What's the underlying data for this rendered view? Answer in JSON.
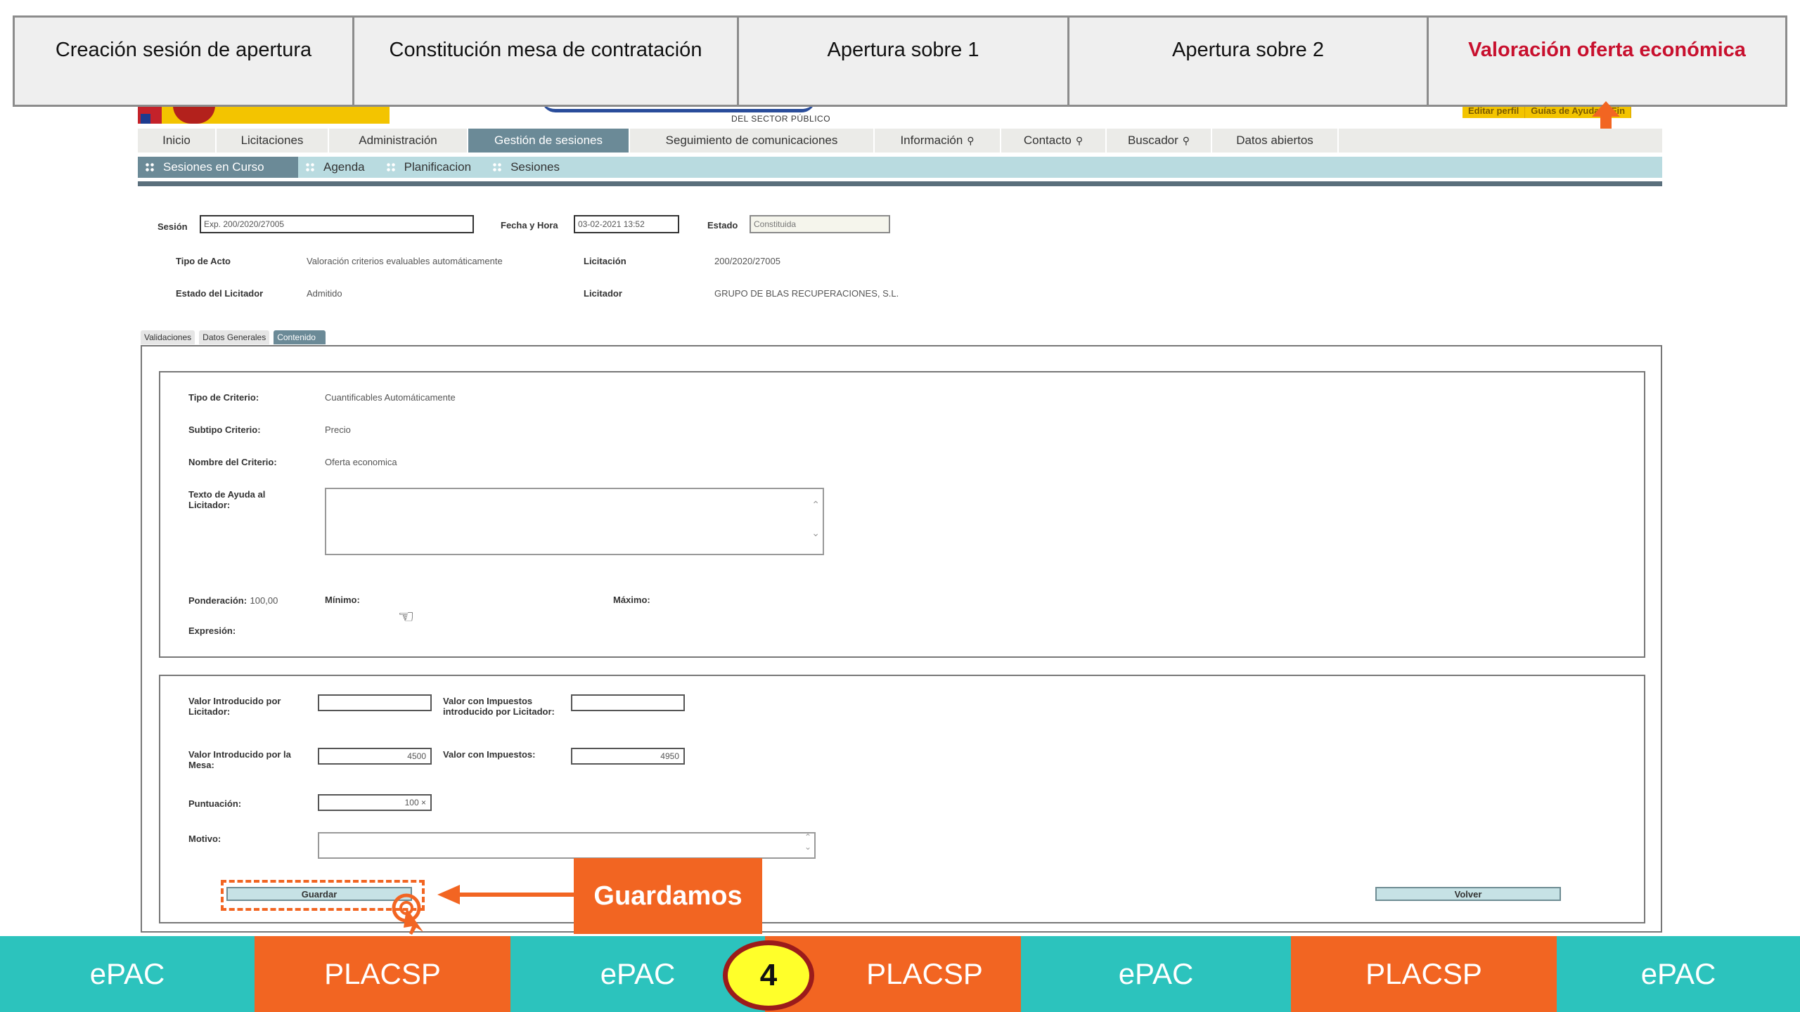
{
  "steps": [
    {
      "label": "Creación sesión de apertura",
      "active": false
    },
    {
      "label": "Constitución mesa de contratación",
      "active": false
    },
    {
      "label": "Apertura sobre 1",
      "active": false
    },
    {
      "label": "Apertura sobre 2",
      "active": false
    },
    {
      "label": "Valoración oferta económica",
      "active": true
    }
  ],
  "header": {
    "logo_sub": "DEL SECTOR PÚBLICO",
    "top_links": [
      "Editar perfil",
      "Guías de Ayuda",
      "Fin"
    ]
  },
  "main_nav": [
    "Inicio",
    "Licitaciones",
    "Administración",
    "Gestión de sesiones",
    "Seguimiento de comunicaciones",
    "Información",
    "Contacto",
    "Buscador",
    "Datos abiertos"
  ],
  "main_nav_active": "Gestión de sesiones",
  "sub_nav": [
    "Sesiones en Curso",
    "Agenda",
    "Planificacion",
    "Sesiones"
  ],
  "session": {
    "sesion_label": "Sesión",
    "sesion_value": "Exp. 200/2020/27005",
    "fecha_label": "Fecha y Hora",
    "fecha_value": "03-02-2021 13:52",
    "estado_label": "Estado",
    "estado_value": "Constituida",
    "tipo_acto_label": "Tipo de Acto",
    "tipo_acto_value": "Valoración criterios evaluables automáticamente",
    "licitacion_label": "Licitación",
    "licitacion_value": "200/2020/27005",
    "estado_licitador_label": "Estado del Licitador",
    "estado_licitador_value": "Admitido",
    "licitador_label": "Licitador",
    "licitador_value": "GRUPO DE BLAS RECUPERACIONES, S.L."
  },
  "tabs": [
    "Validaciones",
    "Datos Generales",
    "Contenido"
  ],
  "criterio": {
    "tipo_label": "Tipo de Criterio:",
    "tipo_value": "Cuantificables Automáticamente",
    "subtipo_label": "Subtipo Criterio:",
    "subtipo_value": "Precio",
    "nombre_label": "Nombre del Criterio:",
    "nombre_value": "Oferta economica",
    "ayuda_label": "Texto de Ayuda al Licitador:",
    "ponderacion_label": "Ponderación:",
    "ponderacion_value": "100,00",
    "minimo_label": "Mínimo:",
    "maximo_label": "Máximo:",
    "expresion_label": "Expresión:"
  },
  "valores": {
    "licitador_label": "Valor Introducido por Licitador:",
    "impuestos_licitador_label": "Valor con Impuestos introducido por Licitador:",
    "mesa_label": "Valor Introducido por la Mesa:",
    "mesa_value": "4500",
    "impuestos_label": "Valor con Impuestos:",
    "impuestos_value": "4950",
    "puntuacion_label": "Puntuación:",
    "puntuacion_value": "100 ×",
    "motivo_label": "Motivo:"
  },
  "buttons": {
    "guardar": "Guardar",
    "volver": "Volver"
  },
  "callout": "Guardamos",
  "flow": [
    {
      "label": "ePAC",
      "kind": "epac"
    },
    {
      "label": "PLACSP",
      "kind": "placsp"
    },
    {
      "label": "ePAC",
      "kind": "epac"
    },
    {
      "label": "PLACSP",
      "kind": "placsp"
    },
    {
      "label": "ePAC",
      "kind": "epac"
    },
    {
      "label": "PLACSP",
      "kind": "placsp"
    },
    {
      "label": "ePAC",
      "kind": "epac"
    }
  ],
  "step_number": "4",
  "colors": {
    "accent_orange": "#f26522",
    "teal": "#2cc3bd",
    "active_red": "#c8102e",
    "nav_active": "#6b8a97"
  }
}
